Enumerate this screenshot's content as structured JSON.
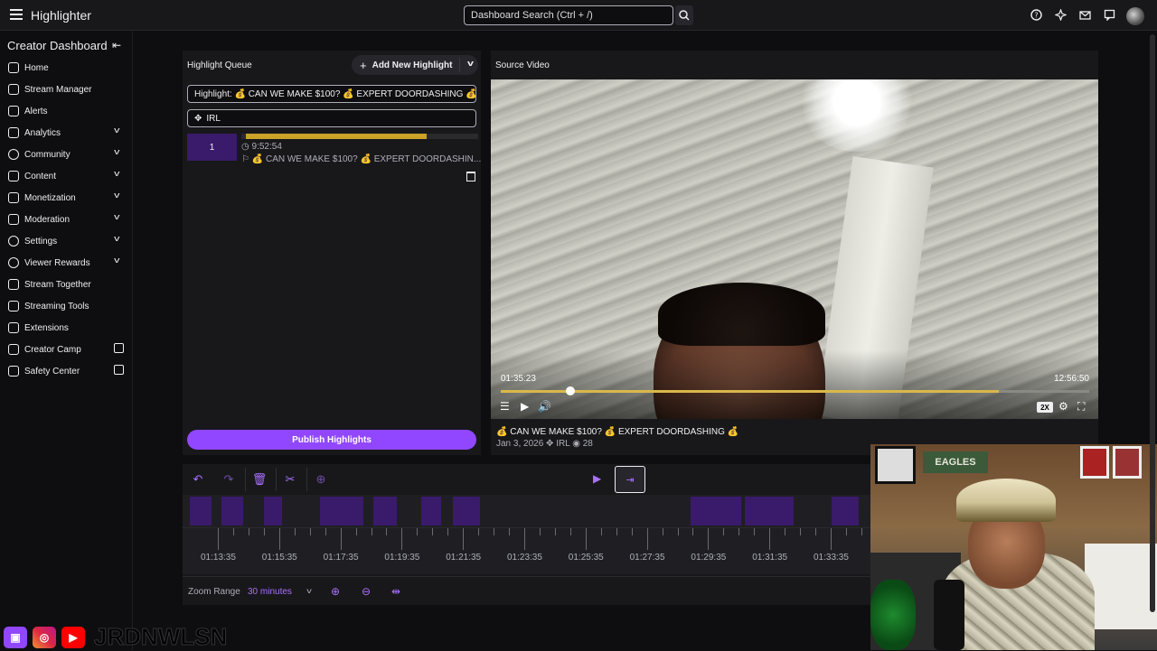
{
  "topbar": {
    "app_title": "Highlighter",
    "search_placeholder": "Dashboard Search (Ctrl + /)",
    "icons": [
      "help-icon",
      "sparkle-icon",
      "inbox-icon",
      "whisper-icon",
      "user-avatar"
    ]
  },
  "sidebar": {
    "title": "Creator Dashboard",
    "items": [
      {
        "label": "Home",
        "icon": "home-icon",
        "expandable": false
      },
      {
        "label": "Stream Manager",
        "icon": "stream-manager-icon",
        "expandable": false
      },
      {
        "label": "Alerts",
        "icon": "alerts-icon",
        "expandable": false
      },
      {
        "label": "Analytics",
        "icon": "analytics-icon",
        "expandable": true
      },
      {
        "label": "Community",
        "icon": "community-icon",
        "expandable": true
      },
      {
        "label": "Content",
        "icon": "content-icon",
        "expandable": true
      },
      {
        "label": "Monetization",
        "icon": "monetization-icon",
        "expandable": true
      },
      {
        "label": "Moderation",
        "icon": "moderation-icon",
        "expandable": true
      },
      {
        "label": "Settings",
        "icon": "settings-icon",
        "expandable": true
      },
      {
        "label": "Viewer Rewards",
        "icon": "viewer-rewards-icon",
        "expandable": true
      },
      {
        "label": "Stream Together",
        "icon": "stream-together-icon",
        "expandable": false
      },
      {
        "label": "Streaming Tools",
        "icon": "streaming-tools-icon",
        "expandable": false
      },
      {
        "label": "Extensions",
        "icon": "extensions-icon",
        "expandable": false
      },
      {
        "label": "Creator Camp",
        "icon": "creator-camp-icon",
        "external": true
      },
      {
        "label": "Safety Center",
        "icon": "safety-center-icon",
        "external": true
      }
    ]
  },
  "queue": {
    "header": "Highlight Queue",
    "add_button": "Add New Highlight",
    "title_field": "Highlight: 💰 CAN WE MAKE $100? 💰 EXPERT DOORDASHING 💰",
    "category_field": "IRL",
    "clip": {
      "number": "1",
      "time": "9:52:54",
      "title": "💰 CAN WE MAKE $100? 💰 EXPERT DOORDASHIN...",
      "progress": 0.8
    },
    "publish_button": "Publish Highlights"
  },
  "source": {
    "header": "Source Video",
    "current_time": "01:35:23",
    "duration": "12:56:50",
    "playback_progress": 0.13,
    "speed": "2X",
    "video_title": "💰 CAN WE MAKE $100? 💰 EXPERT DOORDASHING 💰",
    "date": "Jan 3, 2026",
    "category": "IRL",
    "views": "28"
  },
  "timeline": {
    "tick_labels": [
      "01:13:35",
      "01:15:35",
      "01:17:35",
      "01:19:35",
      "01:21:35",
      "01:23:35",
      "01:25:35",
      "01:27:35",
      "01:29:35",
      "01:31:35",
      "01:33:35"
    ],
    "zoom_label": "Zoom Range",
    "zoom_value": "30 minutes"
  },
  "overlay": {
    "sign_text": "EAGLES",
    "handle": "JRDNWLSN"
  }
}
